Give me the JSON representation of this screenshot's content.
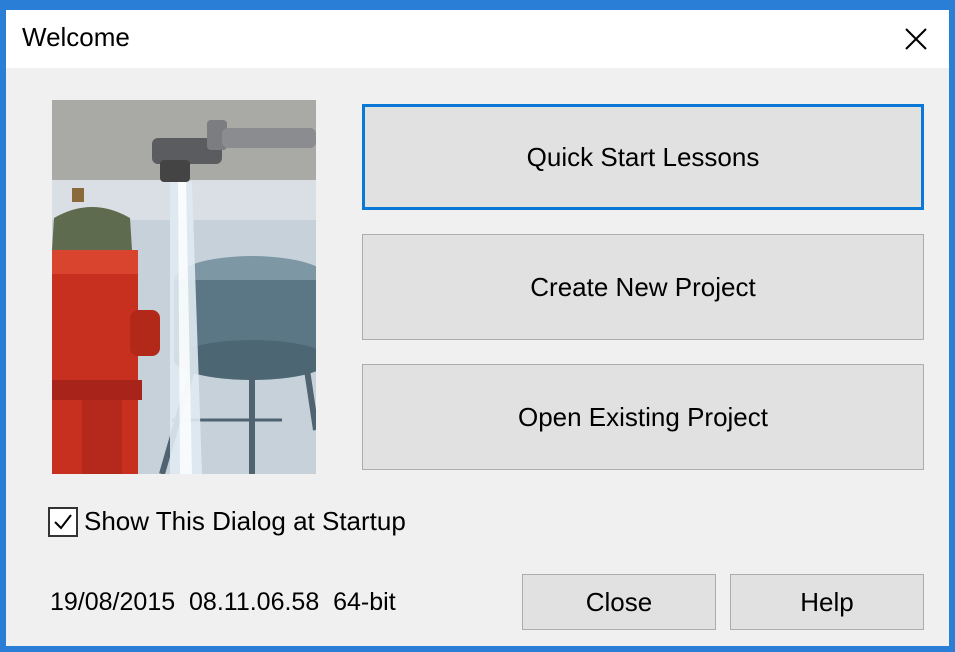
{
  "window": {
    "title": "Welcome",
    "accent_color": "#2b7ed6"
  },
  "icons": {
    "close": "close-icon",
    "checkmark": "checkmark-icon"
  },
  "buttons": {
    "quick_start": "Quick Start Lessons",
    "create_project": "Create New Project",
    "open_project": "Open Existing Project",
    "close": "Close",
    "help": "Help"
  },
  "startup": {
    "label": "Show This Dialog at Startup",
    "checked": true
  },
  "version": {
    "text": "19/08/2015  08.11.06.58  64-bit"
  }
}
